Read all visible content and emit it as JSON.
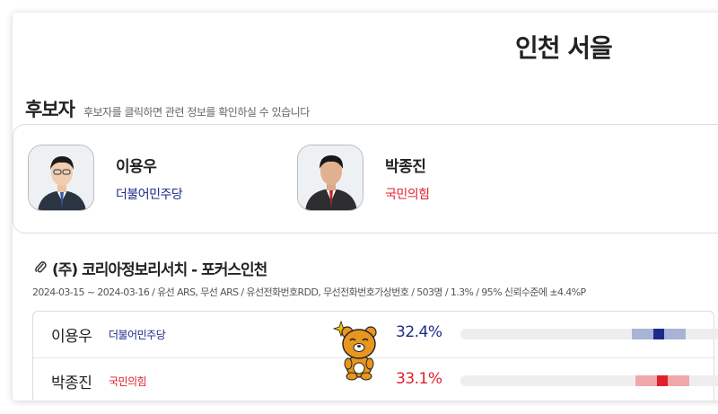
{
  "region": {
    "title": "인천 서을"
  },
  "candidates_section": {
    "heading": "후보자",
    "hint": "후보자를 클릭하면 관련 정보를 확인하실 수 있습니다",
    "candidates": [
      {
        "name": "이용우",
        "party": "더불어민주당",
        "party_color": "#1b2a8a"
      },
      {
        "name": "박종진",
        "party": "국민의힘",
        "party_color": "#e0202d"
      }
    ]
  },
  "poll": {
    "title": "(주) 코리아정보리서치 - 포커스인천",
    "meta": "2024-03-15 ~ 2024-03-16 / 유선 ARS, 무선 ARS / 유선전화번호RDD, 무선전화번호가상번호 / 503명 / 1.3% / 95% 신뢰수준에 ±4.4%P",
    "results": [
      {
        "name": "이용우",
        "party": "더불어민주당",
        "percent_label": "32.4%",
        "percent": 32.4,
        "party_color": "#1b2a8a",
        "ci_color": "#a9b3d6"
      },
      {
        "name": "박종진",
        "party": "국민의힘",
        "percent_label": "33.1%",
        "percent": 33.1,
        "party_color": "#e0202d",
        "ci_color": "#f0a7ac"
      }
    ]
  },
  "icons": {
    "attachment": "paperclip-icon",
    "mascot": "bear-mascot-icon"
  }
}
